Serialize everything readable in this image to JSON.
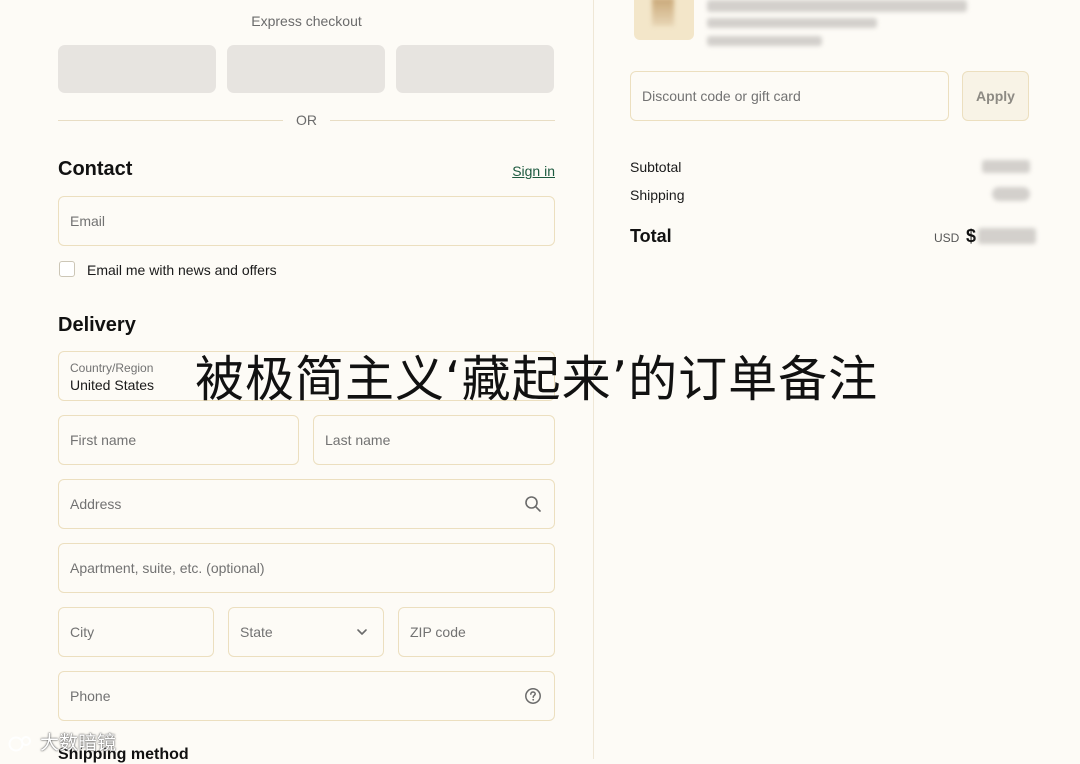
{
  "express_checkout": {
    "title": "Express checkout",
    "separator": "OR"
  },
  "contact": {
    "title": "Contact",
    "sign_in": "Sign in",
    "email_placeholder": "Email",
    "news_checkbox_label": "Email me with news and offers"
  },
  "delivery": {
    "title": "Delivery",
    "country_label": "Country/Region",
    "country_value": "United States",
    "first_name_placeholder": "First name",
    "last_name_placeholder": "Last name",
    "address_placeholder": "Address",
    "apartment_placeholder": "Apartment, suite, etc. (optional)",
    "city_placeholder": "City",
    "state_placeholder": "State",
    "zip_placeholder": "ZIP code",
    "phone_placeholder": "Phone"
  },
  "shipping_method": {
    "title": "Shipping method"
  },
  "summary": {
    "discount_placeholder": "Discount code or gift card",
    "apply_label": "Apply",
    "subtotal_label": "Subtotal",
    "shipping_label": "Shipping",
    "total_label": "Total",
    "currency": "USD",
    "currency_symbol": "$"
  },
  "overlay": {
    "caption": "被极简主义‘藏起来’的订单备注",
    "watermark": "大数暗镜"
  },
  "colors": {
    "background": "#fdfbf6",
    "field_border": "#ecdfbf",
    "link": "#1d5a3f",
    "express_button": "#e7e4e0"
  }
}
